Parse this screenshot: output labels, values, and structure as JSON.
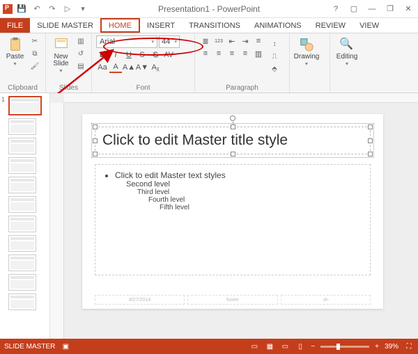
{
  "titlebar": {
    "document_title": "Presentation1 - PowerPoint",
    "qat": {
      "save": "💾",
      "undo": "↶",
      "redo": "↷",
      "start": "▷",
      "customize": "▾"
    }
  },
  "window_controls": {
    "help": "?",
    "ribbon_opts": "▢",
    "minimize": "—",
    "restore": "❐",
    "close": "✕"
  },
  "tabs": {
    "file": "FILE",
    "slide_master": "SLIDE MASTER",
    "home": "HOME",
    "insert": "INSERT",
    "transitions": "TRANSITIONS",
    "animations": "ANIMATIONS",
    "review": "REVIEW",
    "view": "VIEW"
  },
  "ribbon": {
    "clipboard": {
      "label": "Clipboard",
      "paste": "Paste",
      "cut": "✂",
      "copy": "⧉",
      "fmt": "🖌"
    },
    "slides": {
      "label": "Slides",
      "new_slide": "New\nSlide",
      "layout": "▥",
      "reset": "↺",
      "section": "▤"
    },
    "font": {
      "label": "Font",
      "name": "Arial",
      "size": "44",
      "grow": "A▲",
      "shrink": "A▼",
      "clear": "Aᵪ",
      "bold": "B",
      "italic": "I",
      "underline": "U",
      "strike": "S",
      "shadow": "S",
      "spacing": "AV",
      "case": "Aa",
      "color": "A",
      "highlight": "A"
    },
    "paragraph": {
      "label": "Paragraph",
      "bullets": "≣",
      "numbers": "123",
      "indent_dec": "⇤",
      "indent_inc": "⇥",
      "line_sp": "≡",
      "align_l": "≡",
      "align_c": "≡",
      "align_r": "≡",
      "align_j": "≡",
      "columns": "▥",
      "direction": "↕",
      "align_v": "⎍",
      "smartart": "⬘"
    },
    "drawing": {
      "label": "Drawing"
    },
    "editing": {
      "label": "Editing",
      "find": "🔍"
    }
  },
  "thumbs": {
    "first_index": "1",
    "count": 11
  },
  "slide": {
    "title_placeholder": "Click to edit Master title style",
    "body": {
      "l1": "Click to edit Master text styles",
      "l2": "Second level",
      "l3": "Third level",
      "l4": "Fourth level",
      "l5": "Fifth level"
    },
    "footer": {
      "date": "8/27/2014",
      "center": "footer",
      "num": "‹#›"
    }
  },
  "statusbar": {
    "mode": "SLIDE MASTER",
    "zoom_minus": "−",
    "zoom_plus": "+",
    "zoom_value": "39%",
    "fit": "⛶"
  }
}
